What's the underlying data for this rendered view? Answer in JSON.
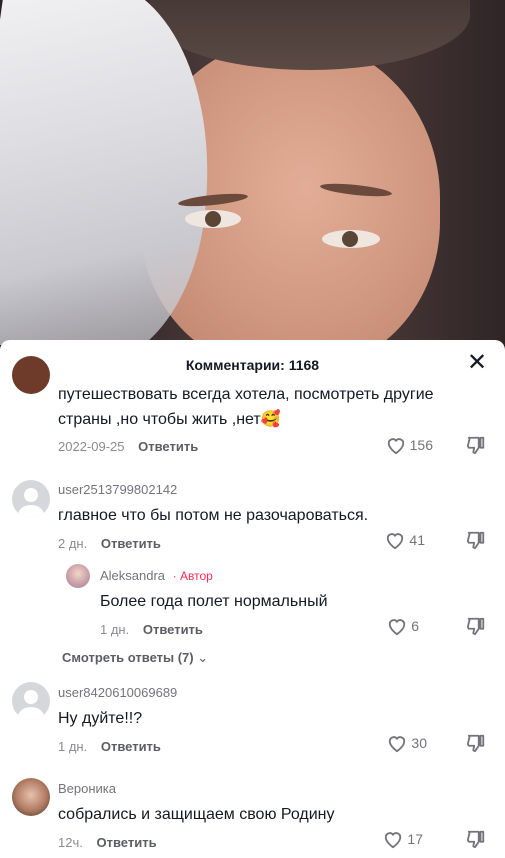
{
  "sheet": {
    "title": "Комментарии: 1168",
    "close_icon": "✕"
  },
  "comments": [
    {
      "text_line1": "путешествовать всегда хотела, посмотреть другие",
      "text_line2": "страны ,но чтобы жить ,нет🥰",
      "date": "2022-09-25",
      "reply_label": "Ответить",
      "likes": "156"
    },
    {
      "username": "user2513799802142",
      "text": "главное что бы потом не разочароваться.",
      "date": "2 дн.",
      "reply_label": "Ответить",
      "likes": "41"
    },
    {
      "username": "Aleksandra",
      "badge": "· Автор",
      "text": "Более года полет нормальный",
      "date": "1 дн.",
      "reply_label": "Ответить",
      "likes": "6"
    },
    {
      "username": "user8420610069689",
      "text": "Ну дуйте!!?",
      "date": "1 дн.",
      "reply_label": "Ответить",
      "likes": "30"
    },
    {
      "username": "Вероника",
      "text": "собрались и защищаем свою Родину",
      "date": "12ч.",
      "reply_label": "Ответить",
      "likes": "17"
    }
  ],
  "more_replies": "Смотреть ответы (7)",
  "colors": {
    "author_badge": "#fe2c55",
    "text": "#161823",
    "muted": "#8a8b91"
  }
}
